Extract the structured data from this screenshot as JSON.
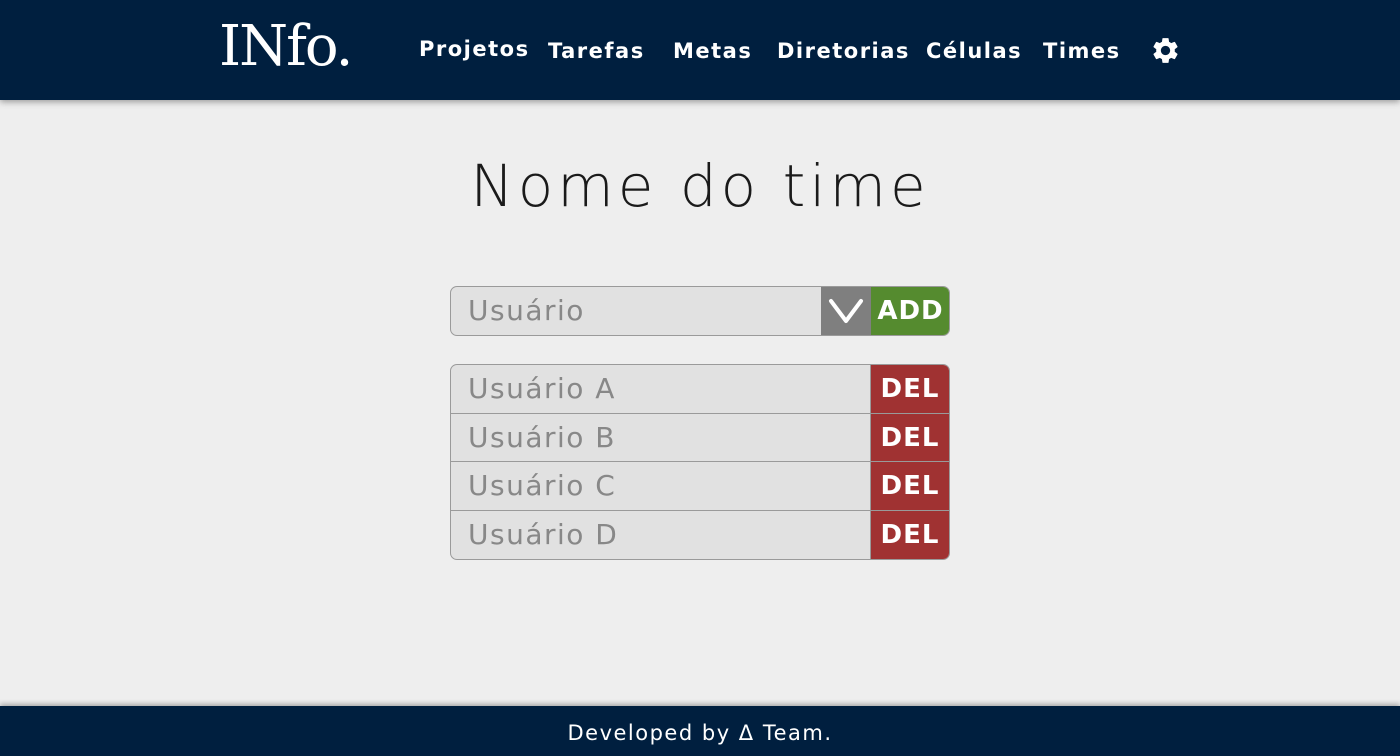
{
  "header": {
    "logo": "INfo.",
    "nav": {
      "projetos": "Projetos",
      "tarefas": "Tarefas",
      "metas": "Metas",
      "diretorias": "Diretorias",
      "celulas": "Células",
      "times": "Times"
    },
    "settings_icon": "gear-icon"
  },
  "main": {
    "title": "Nome do time",
    "add_form": {
      "select_value": "Usuário",
      "dropdown_icon": "chevron-down-icon",
      "add_label": "ADD"
    },
    "members": [
      {
        "name": "Usuário A",
        "del_label": "DEL"
      },
      {
        "name": "Usuário B",
        "del_label": "DEL"
      },
      {
        "name": "Usuário C",
        "del_label": "DEL"
      },
      {
        "name": "Usuário D",
        "del_label": "DEL"
      }
    ]
  },
  "footer": {
    "text": "Developed by Δ Team."
  },
  "colors": {
    "navbar": "#001f3f",
    "background": "#eeeeee",
    "field": "#e1e1e1",
    "dropdown": "#7f7f7f",
    "add_button": "#558b2f",
    "del_button": "#a03232"
  }
}
